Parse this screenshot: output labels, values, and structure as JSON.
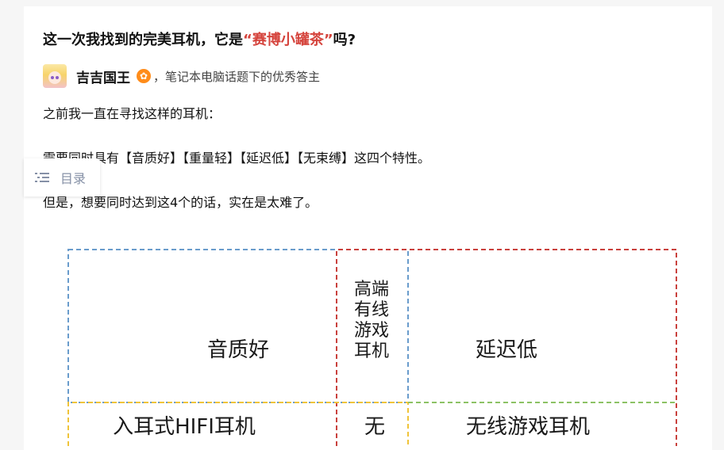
{
  "question": {
    "title_before": "这一次我找到的完美耳机，它是",
    "title_highlight": "“赛博小罐茶”",
    "title_after": "吗?"
  },
  "author": {
    "name": "吉吉国王",
    "badge_icon": "certified-badge-icon",
    "description": "，笔记本电脑话题下的优秀答主"
  },
  "paragraphs": [
    "之前我一直在寻找这样的耳机：",
    "需要同时具有【音质好】【重量轻】【延迟低】【无束缚】这四个特性。",
    "但是，想要同时达到这4个的话，实在是太难了。"
  ],
  "toc": {
    "label": "目录",
    "icon": "list-icon"
  },
  "diagram": {
    "top_left": "音质好",
    "top_middle": [
      "高端",
      "有线",
      "游戏",
      "耳机"
    ],
    "top_right": "延迟低",
    "bottom_left": "入耳式HIFI耳机",
    "bottom_middle": "无",
    "bottom_right": "无线游戏耳机",
    "colors": {
      "blue": "#6a9ccc",
      "red": "#c9413d",
      "yellow": "#f0c43a",
      "green": "#8cc264"
    }
  }
}
